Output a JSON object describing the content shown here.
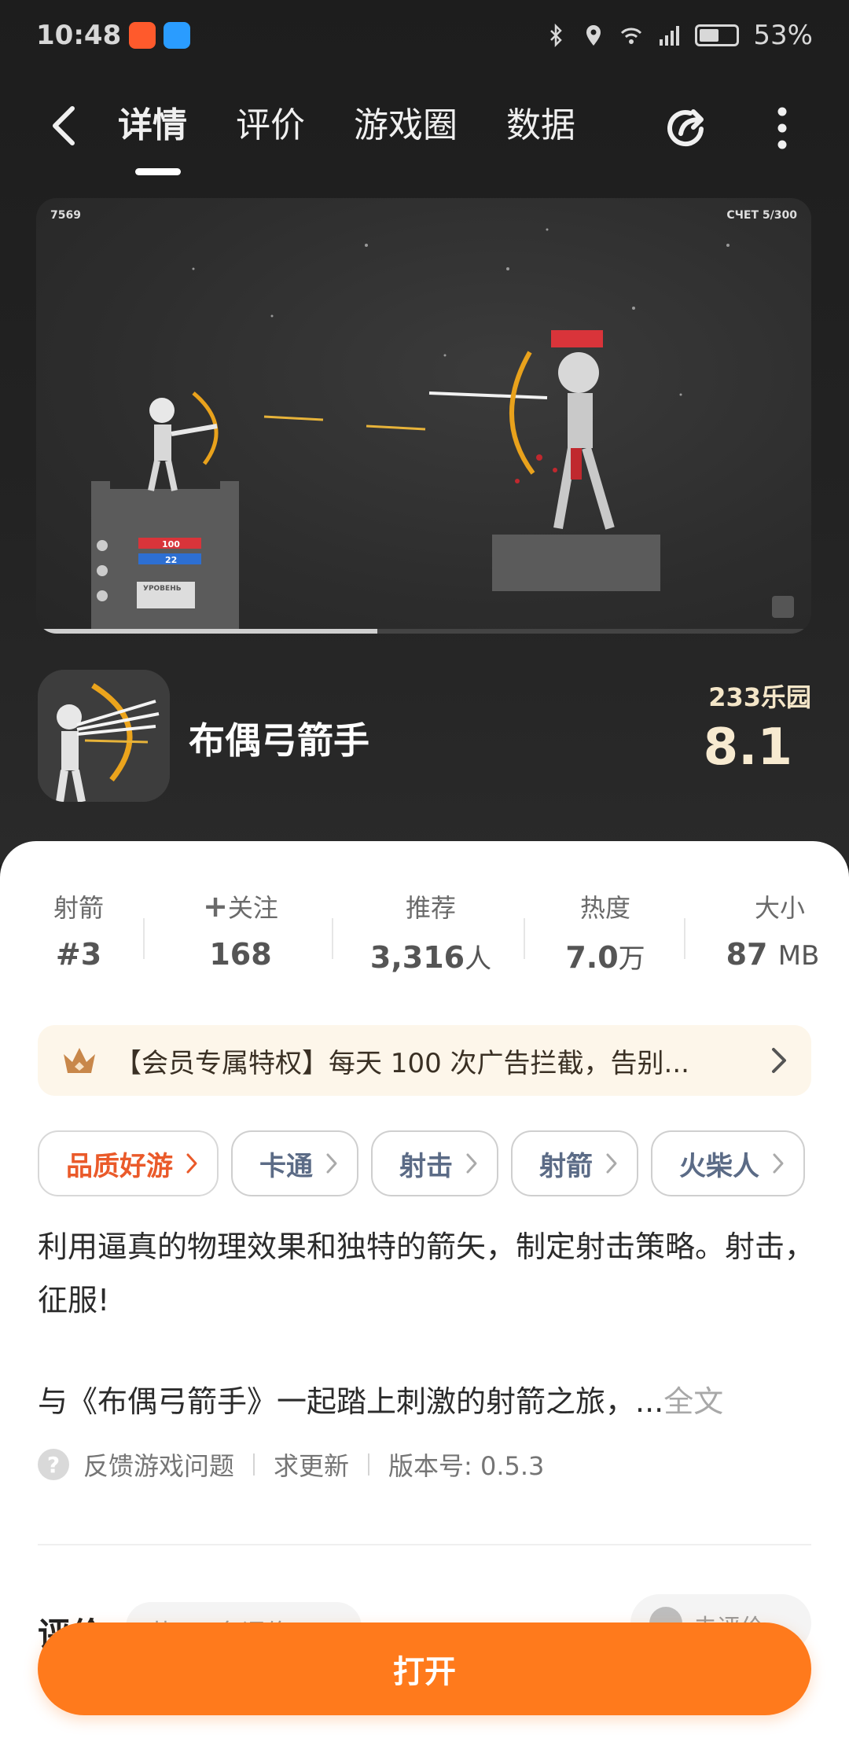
{
  "status_bar": {
    "time": "10:48",
    "battery": "53%"
  },
  "nav": {
    "tabs": [
      {
        "label": "详情",
        "active": true
      },
      {
        "label": "评价",
        "active": false
      },
      {
        "label": "游戏圈",
        "active": false
      },
      {
        "label": "数据",
        "active": false
      }
    ],
    "icons": [
      "back-icon",
      "share-icon",
      "more-icon"
    ]
  },
  "media": {
    "hud_left": "7569",
    "hud_right": "СЧЕТ 5/300",
    "board_top": "100",
    "board_bottom": "22",
    "level_sign": "УРОВЕНЬ",
    "progress": 0.44
  },
  "game": {
    "title": "布偶弓箭手",
    "rating_brand": "233乐园",
    "rating_score": "8.1"
  },
  "stats": [
    {
      "label": "射箭",
      "value": "#3",
      "unit": ""
    },
    {
      "label": "关注",
      "value": "168",
      "unit": "",
      "icon": "plus-icon"
    },
    {
      "label": "推荐",
      "value": "3,316",
      "unit": "人"
    },
    {
      "label": "热度",
      "value": "7.0",
      "unit": "万"
    },
    {
      "label": "大小",
      "value": "87",
      "unit": "MB"
    }
  ],
  "vip_banner": {
    "text": "【会员专属特权】每天 100 次广告拦截，告别..."
  },
  "tags": [
    "品质好游",
    "卡通",
    "射击",
    "射箭",
    "火柴人"
  ],
  "description": {
    "line1": "利用逼真的物理效果和独特的箭矢，制定射击策略。射击，征服!",
    "line2": "与《布偶弓箭手》一起踏上刺激的射箭之旅，...",
    "more": "全文"
  },
  "meta": {
    "feedback": "反馈游戏问题",
    "request_update": "求更新",
    "version": "版本号: 0.5.3"
  },
  "reviews": {
    "title": "评价",
    "count": "共134条评价 >",
    "write": "去评价"
  },
  "open_button": "打开",
  "colors": {
    "accent": "#ff7a1c",
    "quality_tag": "#ea5a2a",
    "rating": "#f7ead0"
  }
}
